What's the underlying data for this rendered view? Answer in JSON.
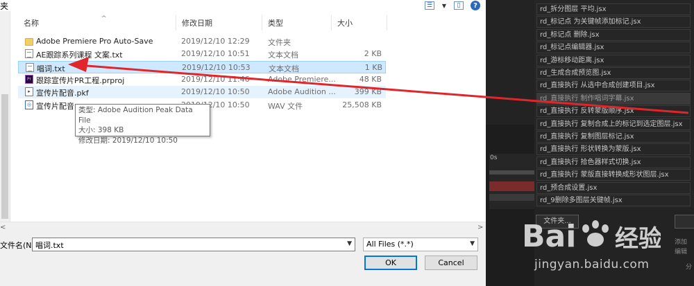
{
  "dialog": {
    "title_fragment": "夹",
    "columns": {
      "name": "名称",
      "date": "修改日期",
      "type": "类型",
      "size": "大小"
    },
    "files": [
      {
        "name": "Adobe Premiere Pro Auto-Save",
        "date": "2019/12/10 12:29",
        "type": "文件夹",
        "size": "",
        "icon": "folder-icon"
      },
      {
        "name": "AE跟踪系列课程 文案.txt",
        "date": "2019/12/10 10:51",
        "type": "文本文档",
        "size": "2 KB",
        "icon": "text-file-icon"
      },
      {
        "name": "唱词.txt",
        "date": "2019/12/10 10:53",
        "type": "文本文档",
        "size": "1 KB",
        "icon": "text-file-icon"
      },
      {
        "name": "跟踪宣传片PR工程.prproj",
        "date": "2019/12/10 11:46",
        "type": "Adobe Premiere...",
        "size": "48 KB",
        "icon": "premiere-file-icon"
      },
      {
        "name": "宣传片配音.pkf",
        "date": "2019/12/10 10:50",
        "type": "Adobe Audition ...",
        "size": "399 KB",
        "icon": "audition-file-icon"
      },
      {
        "name": "宣传片配音.wav",
        "date": "2019/12/10 10:50",
        "type": "WAV 文件",
        "size": "25,508 KB",
        "icon": "wav-file-icon"
      }
    ],
    "tooltip": {
      "line1": "类型: Adobe Audition Peak Data File",
      "line2": "大小: 398 KB",
      "line3": "修改日期: 2019/12/10 10:50"
    },
    "filename_label": "文件名(N):",
    "filename_value": "唱词.txt",
    "filetype_value": "All Files (*.*)",
    "ok_label": "OK",
    "cancel_label": "Cancel",
    "scroll_left": "<",
    "scroll_right": ">"
  },
  "scripts": {
    "items": [
      "rd_拆分图层 平均.jsx",
      "rd_标记点 为关键帧添加标记.jsx",
      "rd_标记点 删除.jsx",
      "rd_标记点编辑器.jsx",
      "rd_游标移动距离.jsx",
      "rd_生成合成预览图.jsx",
      "rd_直接执行 从选中合成创建项目.jsx",
      "rd_直接执行 制作唱词字幕.jsx",
      "rd_直接执行 反转蒙版顺序.jsx",
      "rd_直接执行 复制合成上的标记到选定图层.jsx",
      "rd_直接执行 复制图层标记.jsx",
      "rd_直接执行 形状转换为蒙版.jsx",
      "rd_直接执行 拾色器样式切换.jsx",
      "rd_直接执行 蒙版直接转换成形状图层.jsx",
      "rd_预合成设置.jsx",
      "rd_9删除多图层关键帧.jsx"
    ],
    "highlighted_index": 7,
    "file_button": "文件夹...",
    "timeline_label": "0s",
    "footer_texts": [
      "添加",
      "编辑",
      "分"
    ]
  },
  "watermark": {
    "brand": "Bai 经验",
    "url": "jingyan.baidu.com"
  },
  "colors": {
    "selection": "#cde8ff",
    "arrow": "#e0262b",
    "dark_bg": "#232323"
  }
}
